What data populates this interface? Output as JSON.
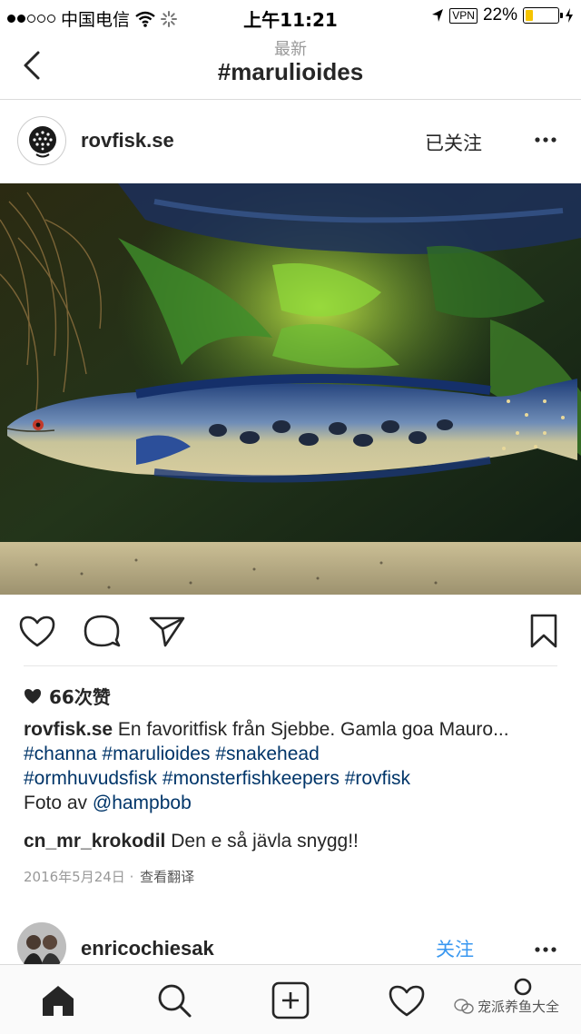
{
  "status_bar": {
    "carrier": "中国电信",
    "time": "上午11:21",
    "vpn": "VPN",
    "battery": "22%",
    "battery_level": 0.22
  },
  "nav": {
    "subtitle": "最新",
    "title": "#marulioides"
  },
  "post": {
    "username": "rovfisk.se",
    "follow_state": "已关注",
    "likes": "66次赞",
    "caption": {
      "username": "rovfisk.se",
      "text_1": " En favoritfisk från Sjebbe. Gamla goa Mauro... ",
      "tags_line1": [
        "#channa",
        "#marulioides",
        "#snakehead"
      ],
      "tags_line2": [
        "#ormhuvudsfisk",
        "#monsterfishkeepers",
        "#rovfisk"
      ],
      "photo_by_prefix": "Foto av ",
      "photo_by_mention": "@hampbob"
    },
    "comment": {
      "username": "cn_mr_krokodil",
      "text": " Den e så jävla snygg!!"
    },
    "date": "2016年5月24日",
    "separator": " · ",
    "translate": "查看翻译"
  },
  "next_post": {
    "username": "enricochiesak",
    "follow_label": "关注"
  },
  "watermark": "宠派养鱼大全",
  "colors": {
    "link": "#003569",
    "follow_blue": "#3897f0",
    "battery": "#f5c400"
  }
}
